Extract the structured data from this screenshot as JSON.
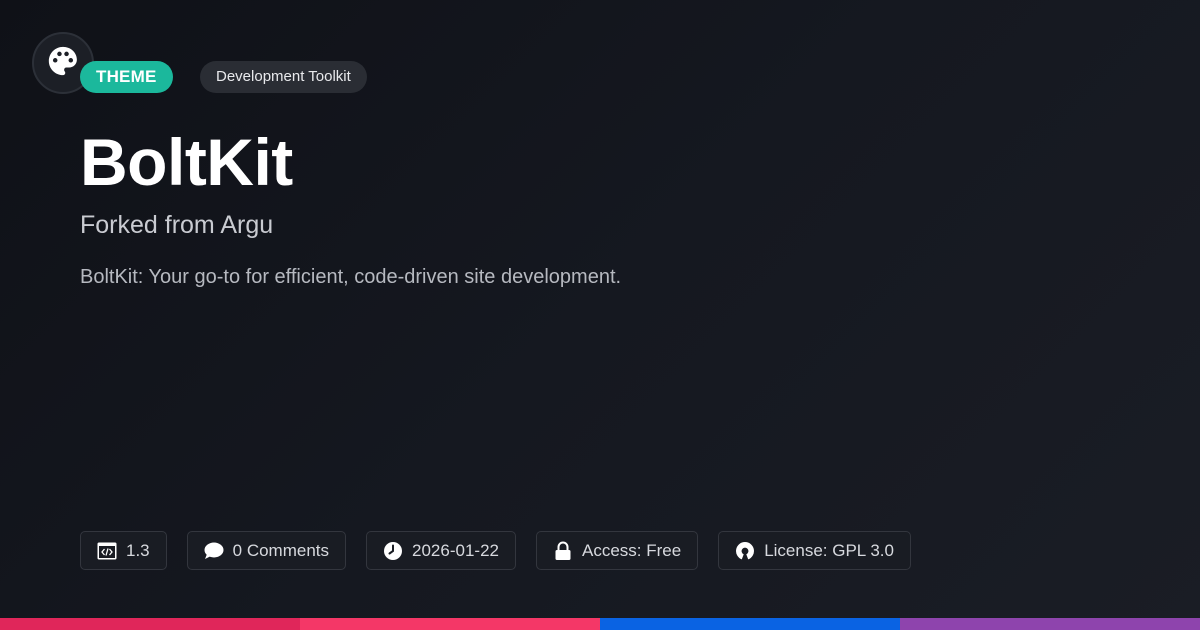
{
  "header": {
    "logo_icon": "palette-icon",
    "type_badge": "THEME",
    "category_badge": "Development Toolkit"
  },
  "main": {
    "title": "BoltKit",
    "subtitle": "Forked from Argu",
    "description": "BoltKit: Your go-to for efficient, code-driven site development."
  },
  "meta": {
    "version": {
      "icon": "code-window-icon",
      "label": "1.3"
    },
    "comments": {
      "icon": "chat-bubble-icon",
      "label": "0 Comments"
    },
    "date": {
      "icon": "clock-icon",
      "label": "2026-01-22"
    },
    "access": {
      "icon": "lock-icon",
      "label": "Access: Free"
    },
    "license": {
      "icon": "open-source-icon",
      "label": "License: GPL 3.0"
    }
  },
  "colors": {
    "accent_theme": "#1bb89c",
    "bar_segments": [
      "#e0265a",
      "#f43767",
      "#0a63e3",
      "#8e44ad"
    ]
  }
}
